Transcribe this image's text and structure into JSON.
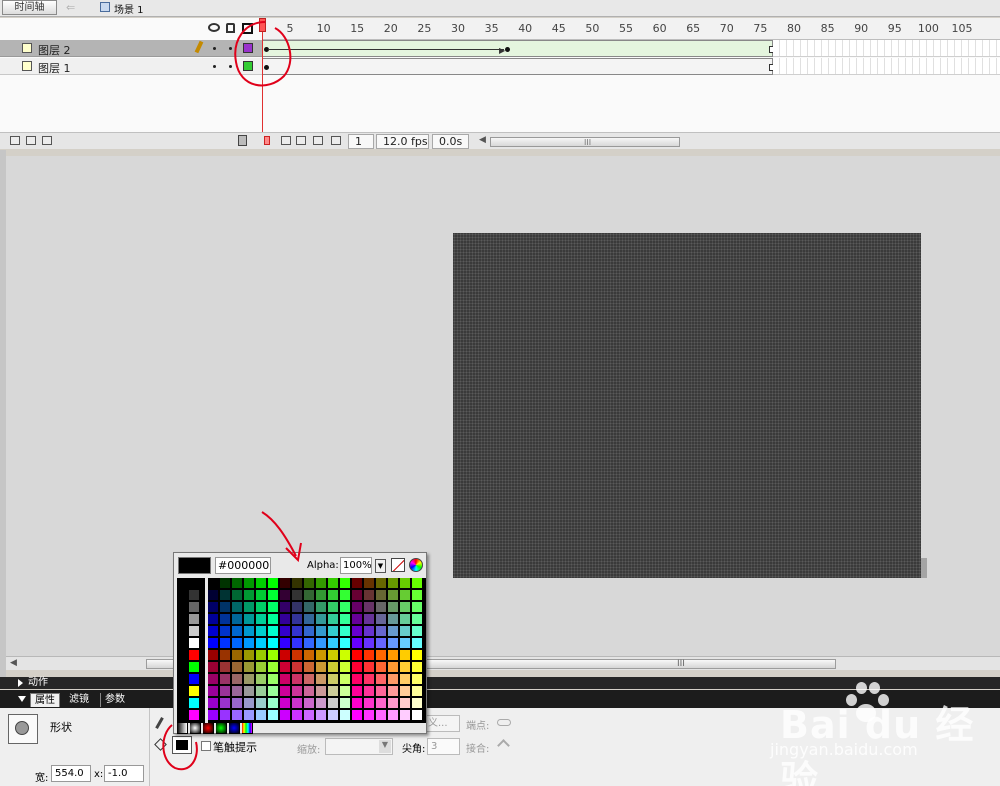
{
  "topbar": {
    "timeline_button": "时间轴",
    "scene_label": "场景 1"
  },
  "timeline": {
    "ruler_ticks": [
      "5",
      "10",
      "15",
      "20",
      "25",
      "30",
      "35",
      "40",
      "45",
      "50",
      "55",
      "60",
      "65",
      "70",
      "75",
      "80",
      "85",
      "90",
      "95",
      "100",
      "105"
    ],
    "layers": [
      {
        "name": "图层 2",
        "color": "#9933cc",
        "selected": true
      },
      {
        "name": "图层 1",
        "color": "#33cc33",
        "selected": false
      }
    ],
    "current_frame": "1",
    "fps": "12.0 fps",
    "elapsed": "0.0s",
    "scroll_grip": "III"
  },
  "stage": {
    "canvas_color": "#3a3a3a",
    "scroll_grip": "III"
  },
  "panels": {
    "actions_label": "动作",
    "tabs": [
      "属性",
      "滤镜",
      "参数"
    ]
  },
  "properties": {
    "shape_label": "形状",
    "stroke_hint_label": "笔触提示",
    "scale_label": "缩放:",
    "miter_label": "尖角:",
    "miter_value": "3",
    "custom_label": "义...",
    "cap_label": "端点:",
    "join_label": "接合:",
    "width_label": "宽:",
    "width_value": "554.0",
    "x_label": "x:",
    "x_value": "-1.0"
  },
  "palette": {
    "hex_value": "#000000",
    "alpha_label": "Alpha:",
    "alpha_value": "100%",
    "alpha_drop": "▼"
  },
  "watermark": {
    "brand": "Bai  du 经验",
    "url": "jingyan.baidu.com"
  },
  "annotation_color": "#e0001a"
}
